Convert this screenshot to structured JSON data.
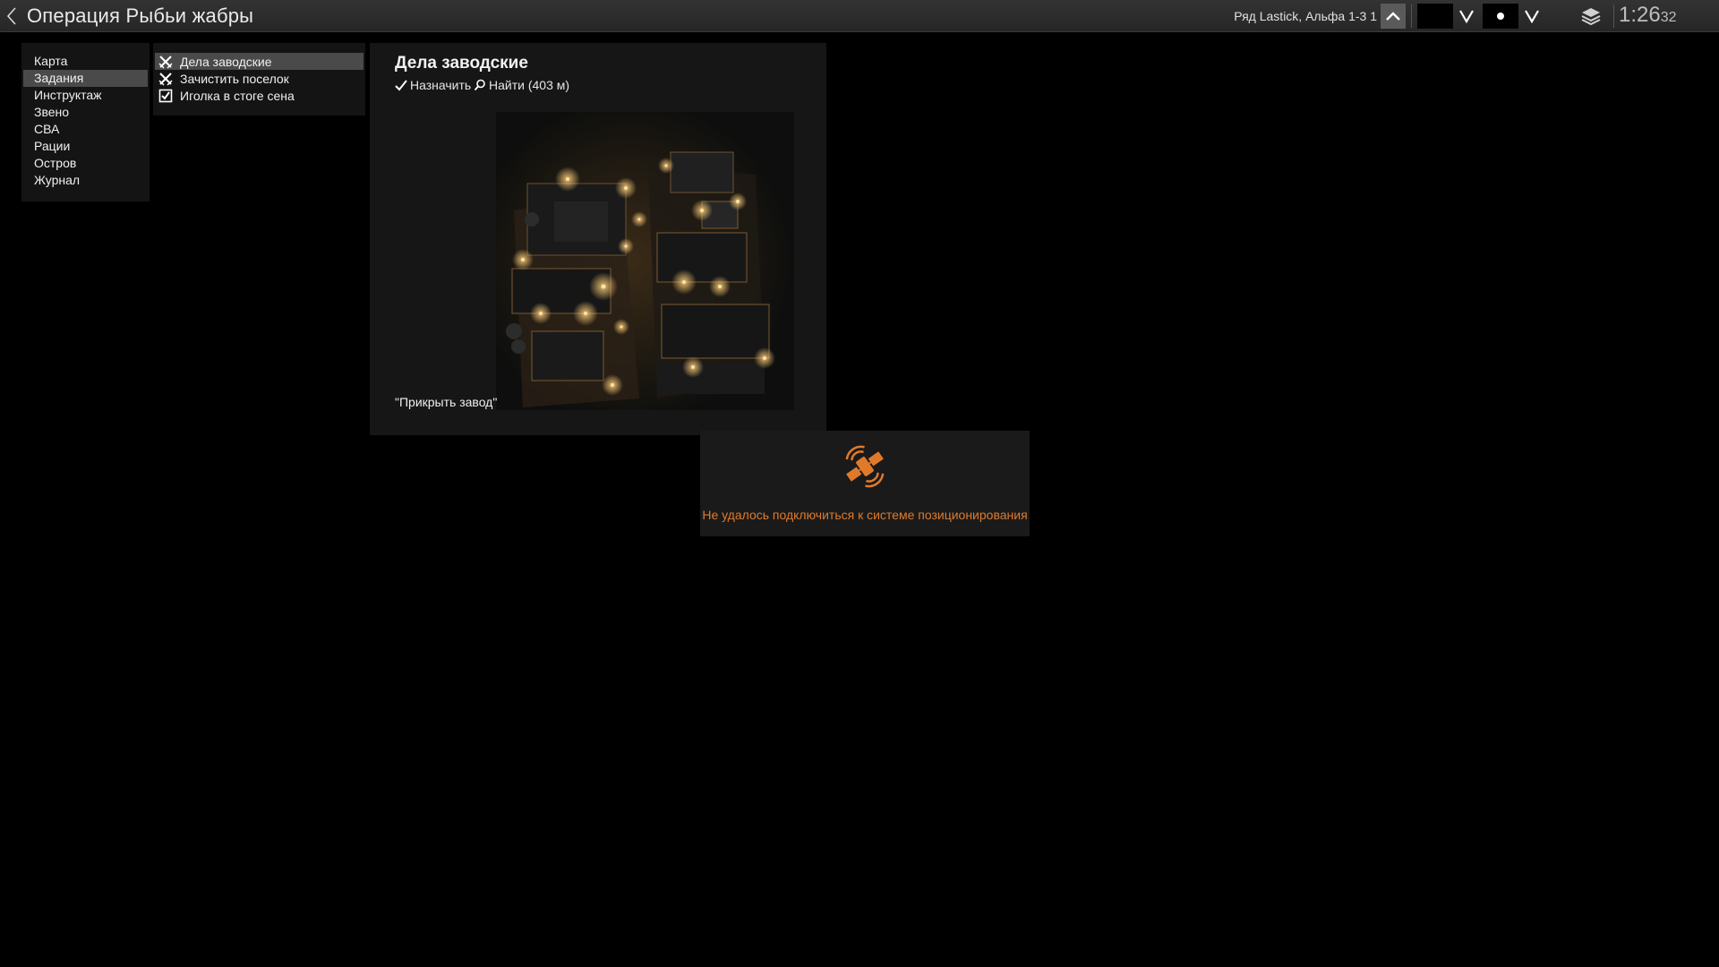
{
  "header": {
    "title": "Операция Рыбьи жабры",
    "unit_label": "Ряд Lastick, Альфа 1-3 1",
    "clock_hm": "1:26",
    "clock_sec": "32"
  },
  "menu": {
    "items": [
      {
        "label": "Карта",
        "active": false
      },
      {
        "label": "Задания",
        "active": true
      },
      {
        "label": "Инструктаж",
        "active": false
      },
      {
        "label": "Звено",
        "active": false
      },
      {
        "label": "СВА",
        "active": false
      },
      {
        "label": "Рации",
        "active": false
      },
      {
        "label": "Остров",
        "active": false
      },
      {
        "label": "Журнал",
        "active": false
      }
    ]
  },
  "tasks": {
    "items": [
      {
        "label": "Дела заводские",
        "icon": "crossed-swords-icon",
        "active": true
      },
      {
        "label": "Зачистить поселок",
        "icon": "crossed-swords-icon",
        "active": false
      },
      {
        "label": "Иголка в стоге сена",
        "icon": "checked-box-icon",
        "active": false
      }
    ]
  },
  "detail": {
    "title": "Дела заводские",
    "assign_label": "Назначить",
    "find_label": "Найти (403 м)",
    "quote": "\"Прикрыть завод\""
  },
  "gps": {
    "message": "Не удалось подключиться к системе позиционирования",
    "icon": "satellite-icon",
    "color": "#e07a2b"
  }
}
